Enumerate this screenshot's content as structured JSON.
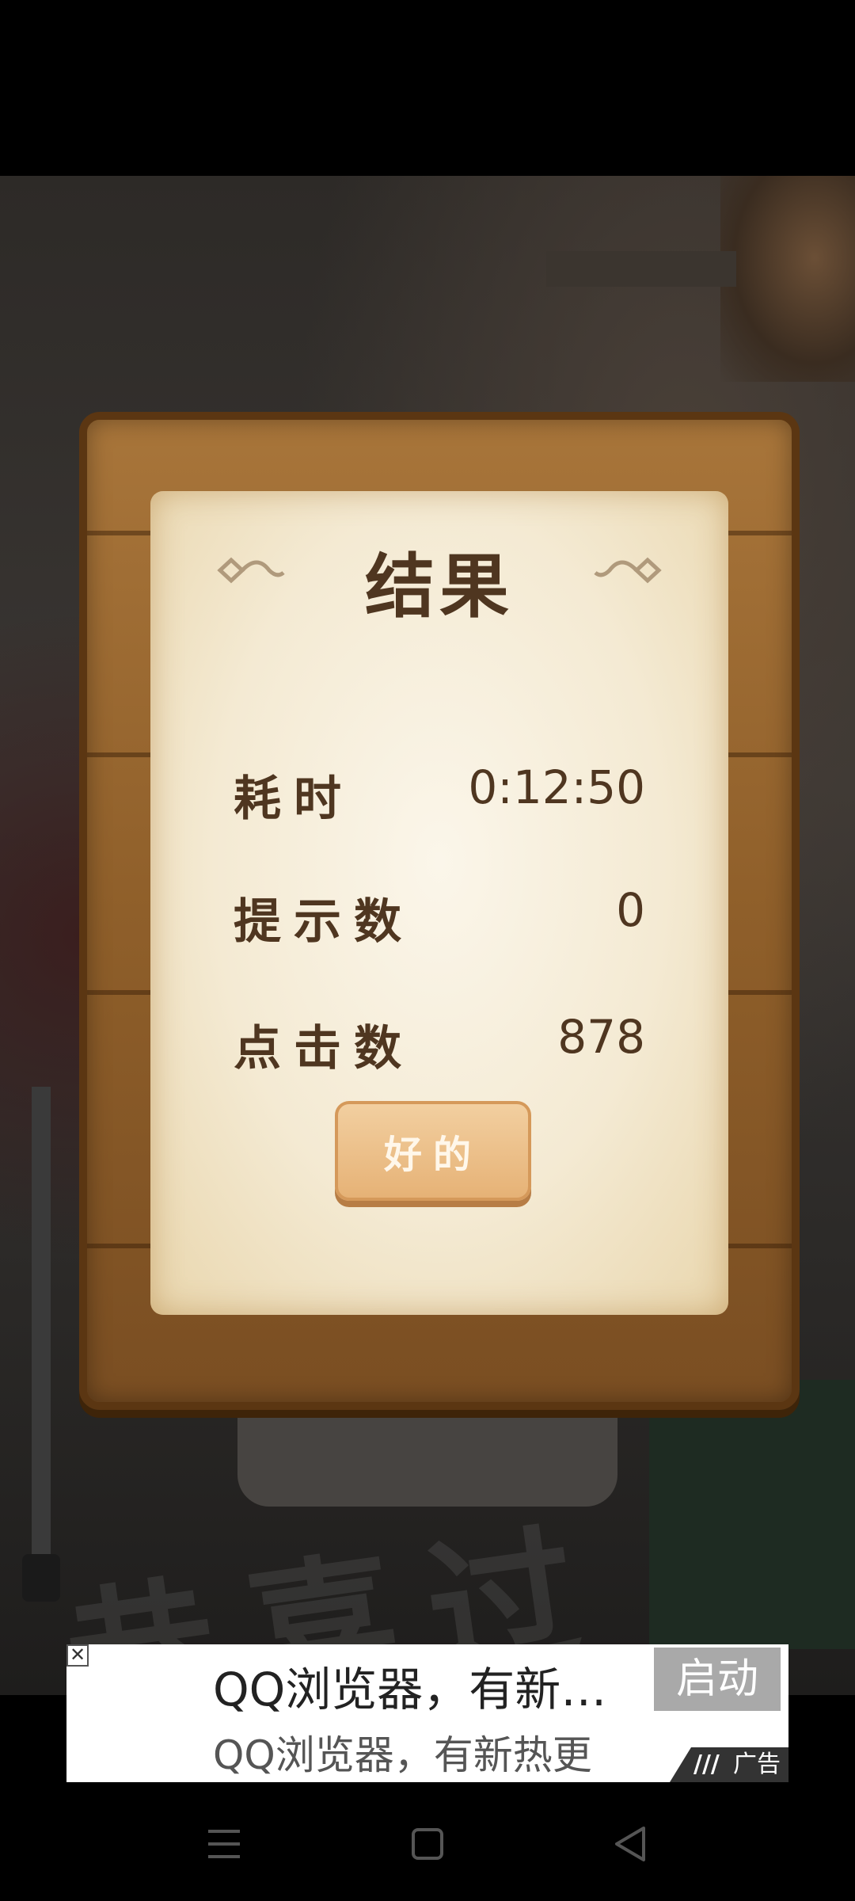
{
  "dialog": {
    "title": "结果",
    "rows": [
      {
        "label": "耗时",
        "value": "0:12:50"
      },
      {
        "label": "提示数",
        "value": "0"
      },
      {
        "label": "点击数",
        "value": "878"
      }
    ],
    "ok_label": "好的"
  },
  "ad": {
    "title": "QQ浏览器，有新…",
    "subtitle": "QQ浏览器，有新热更",
    "button": "启动",
    "tag": "广告",
    "close": "✕"
  },
  "watermark": "恭喜过",
  "navbar": {
    "icons": [
      "menu-icon",
      "home-square-icon",
      "back-triangle-icon"
    ]
  }
}
